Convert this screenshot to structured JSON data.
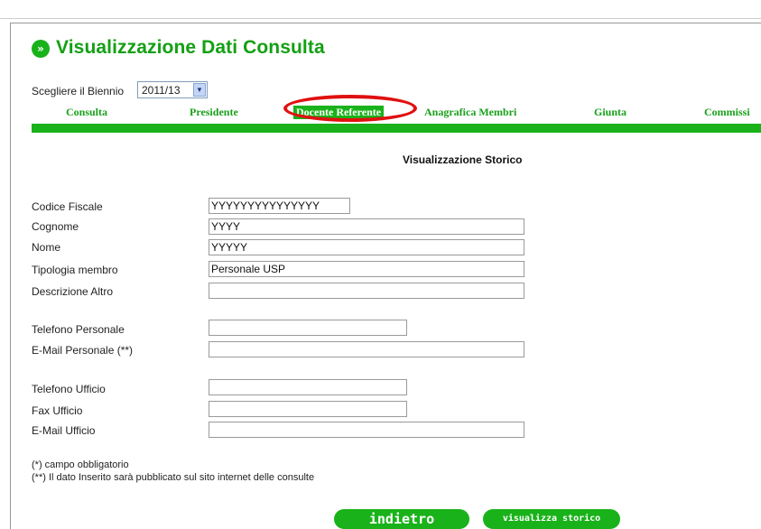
{
  "header": {
    "icon": "double-chevron-right-icon",
    "title": "Visualizzazione Dati Consulta"
  },
  "biennio": {
    "label": "Scegliere il Biennio",
    "selected": "2011/13"
  },
  "tabs": [
    {
      "label": "Consulta"
    },
    {
      "label": "Presidente"
    },
    {
      "label": "Docente Referente",
      "active": true
    },
    {
      "label": "Anagrafica Membri"
    },
    {
      "label": "Giunta"
    },
    {
      "label": "Commissi"
    }
  ],
  "section_title": "Visualizzazione Storico",
  "fields": {
    "codice_fiscale": {
      "label": "Codice Fiscale",
      "value": "YYYYYYYYYYYYYYY"
    },
    "cognome": {
      "label": "Cognome",
      "value": "YYYY"
    },
    "nome": {
      "label": "Nome",
      "value": "YYYYY"
    },
    "tipologia": {
      "label": "Tipologia membro",
      "value": "Personale USP"
    },
    "descrizione_altro": {
      "label": "Descrizione Altro",
      "value": ""
    },
    "telefono_personale": {
      "label": "Telefono Personale",
      "value": ""
    },
    "email_personale": {
      "label": "E-Mail Personale (**)",
      "value": ""
    },
    "telefono_ufficio": {
      "label": "Telefono Ufficio",
      "value": ""
    },
    "fax_ufficio": {
      "label": "Fax Ufficio",
      "value": ""
    },
    "email_ufficio": {
      "label": "E-Mail Ufficio",
      "value": ""
    }
  },
  "notes": {
    "required": "(*) campo obbligatorio",
    "published": "(**) Il dato Inserito sarà pubblicato sul sito internet delle consulte"
  },
  "buttons": {
    "back": "indietro",
    "storico": "visualizza storico"
  },
  "colors": {
    "accent": "#19b21a",
    "highlight": "#e01010"
  }
}
